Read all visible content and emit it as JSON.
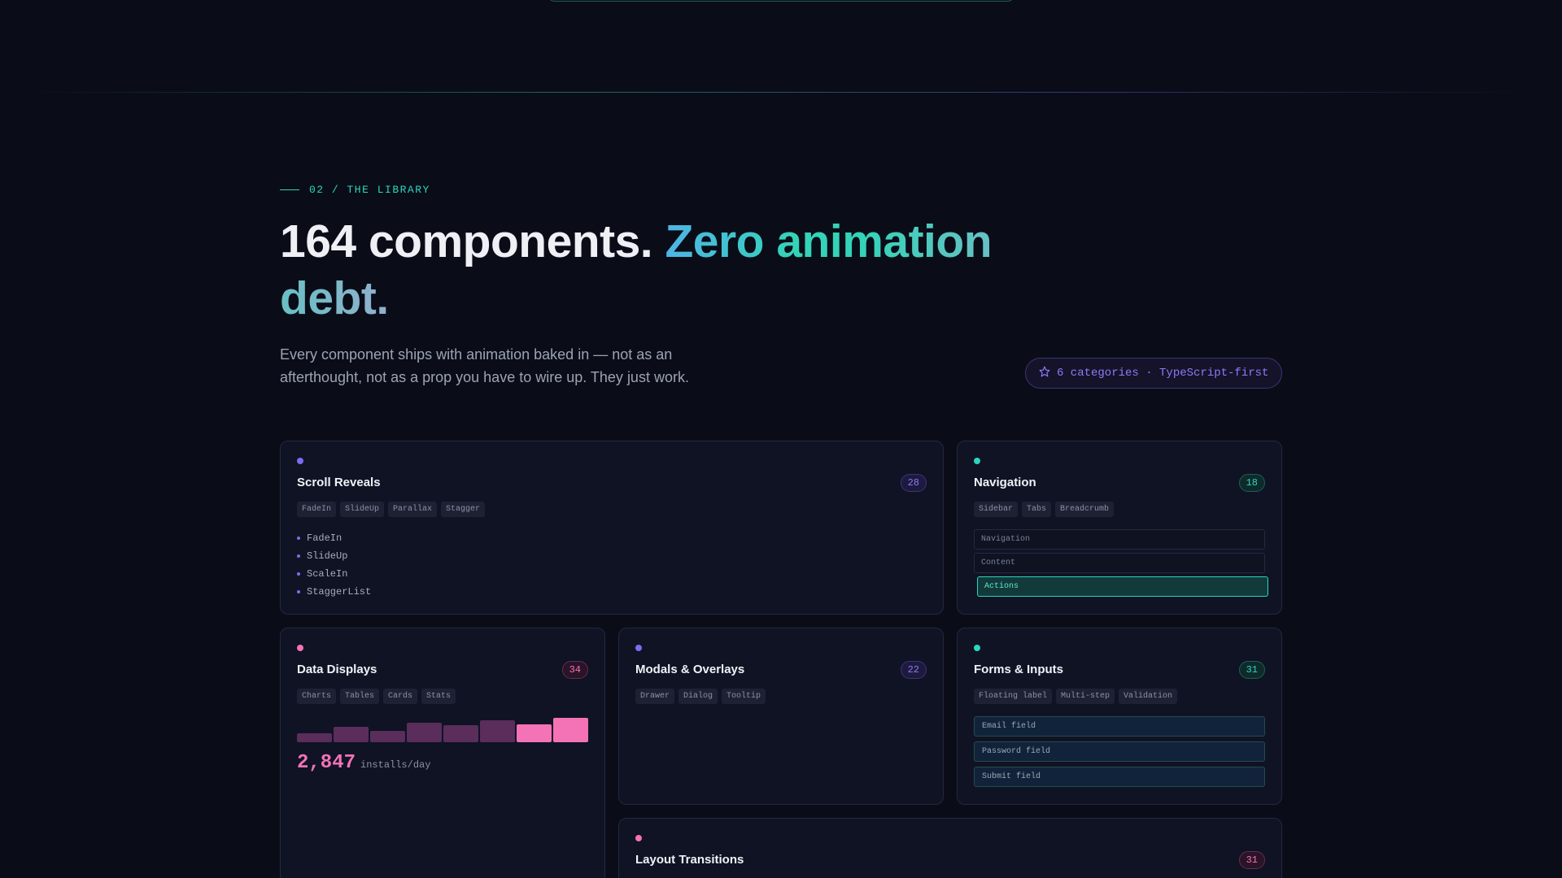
{
  "section": {
    "eyebrow": "02 / THE LIBRARY",
    "headline_main": "164 components.",
    "headline_accent": "Zero animation debt.",
    "subtitle": "Every component ships with animation baked in — not as an afterthought, not as a prop you have to wire up. They just work.",
    "badge": "6 categories · TypeScript-first",
    "badge_icon": "star-icon"
  },
  "colors": {
    "background": "#0a0d17",
    "teal": "#2dd4bf",
    "purple": "#8b7cf6",
    "pink": "#f472b6"
  },
  "cards": {
    "scroll": {
      "title": "Scroll Reveals",
      "count": "28",
      "dot_color": "#7c6cf0",
      "tags": [
        "FadeIn",
        "SlideUp",
        "Parallax",
        "Stagger"
      ],
      "items": [
        "FadeIn",
        "SlideUp",
        "ScaleIn",
        "StaggerList"
      ]
    },
    "navigation": {
      "title": "Navigation",
      "count": "18",
      "dot_color": "#2dd4bf",
      "tags": [
        "Sidebar",
        "Tabs",
        "Breadcrumb"
      ],
      "rows": [
        "Navigation",
        "Content",
        "Actions"
      ],
      "active_row": "Actions"
    },
    "data": {
      "title": "Data Displays",
      "count": "34",
      "dot_color": "#f472b6",
      "tags": [
        "Charts",
        "Tables",
        "Cards",
        "Stats"
      ],
      "bar_levels": [
        0.35,
        0.6,
        0.45,
        0.75,
        0.65,
        0.85,
        0.7,
        0.95
      ],
      "highlight_from": 6,
      "stat_value": "2,847",
      "stat_unit": "installs/day"
    },
    "modals": {
      "title": "Modals & Overlays",
      "count": "22",
      "dot_color": "#7c6cf0",
      "tags": [
        "Drawer",
        "Dialog",
        "Tooltip"
      ]
    },
    "forms": {
      "title": "Forms & Inputs",
      "count": "31",
      "dot_color": "#2dd4bf",
      "tags": [
        "Floating label",
        "Multi-step",
        "Validation"
      ],
      "fields": [
        "Email field",
        "Password field",
        "Submit field"
      ]
    },
    "layout": {
      "title": "Layout Transitions",
      "count": "31",
      "dot_color": "#f472b6"
    }
  }
}
